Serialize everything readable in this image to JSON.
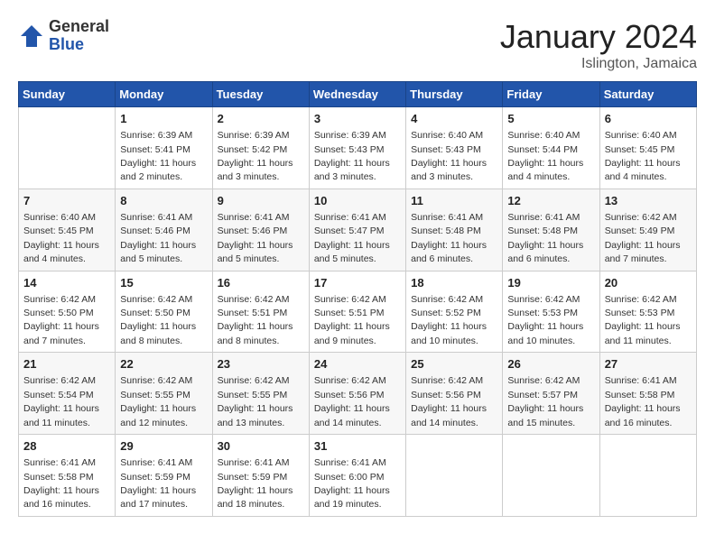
{
  "header": {
    "logo_general": "General",
    "logo_blue": "Blue",
    "month_title": "January 2024",
    "location": "Islington, Jamaica"
  },
  "days_of_week": [
    "Sunday",
    "Monday",
    "Tuesday",
    "Wednesday",
    "Thursday",
    "Friday",
    "Saturday"
  ],
  "weeks": [
    [
      {
        "day": null
      },
      {
        "day": "1",
        "sunrise": "Sunrise: 6:39 AM",
        "sunset": "Sunset: 5:41 PM",
        "daylight": "Daylight: 11 hours and 2 minutes."
      },
      {
        "day": "2",
        "sunrise": "Sunrise: 6:39 AM",
        "sunset": "Sunset: 5:42 PM",
        "daylight": "Daylight: 11 hours and 3 minutes."
      },
      {
        "day": "3",
        "sunrise": "Sunrise: 6:39 AM",
        "sunset": "Sunset: 5:43 PM",
        "daylight": "Daylight: 11 hours and 3 minutes."
      },
      {
        "day": "4",
        "sunrise": "Sunrise: 6:40 AM",
        "sunset": "Sunset: 5:43 PM",
        "daylight": "Daylight: 11 hours and 3 minutes."
      },
      {
        "day": "5",
        "sunrise": "Sunrise: 6:40 AM",
        "sunset": "Sunset: 5:44 PM",
        "daylight": "Daylight: 11 hours and 4 minutes."
      },
      {
        "day": "6",
        "sunrise": "Sunrise: 6:40 AM",
        "sunset": "Sunset: 5:45 PM",
        "daylight": "Daylight: 11 hours and 4 minutes."
      }
    ],
    [
      {
        "day": "7",
        "sunrise": "Sunrise: 6:40 AM",
        "sunset": "Sunset: 5:45 PM",
        "daylight": "Daylight: 11 hours and 4 minutes."
      },
      {
        "day": "8",
        "sunrise": "Sunrise: 6:41 AM",
        "sunset": "Sunset: 5:46 PM",
        "daylight": "Daylight: 11 hours and 5 minutes."
      },
      {
        "day": "9",
        "sunrise": "Sunrise: 6:41 AM",
        "sunset": "Sunset: 5:46 PM",
        "daylight": "Daylight: 11 hours and 5 minutes."
      },
      {
        "day": "10",
        "sunrise": "Sunrise: 6:41 AM",
        "sunset": "Sunset: 5:47 PM",
        "daylight": "Daylight: 11 hours and 5 minutes."
      },
      {
        "day": "11",
        "sunrise": "Sunrise: 6:41 AM",
        "sunset": "Sunset: 5:48 PM",
        "daylight": "Daylight: 11 hours and 6 minutes."
      },
      {
        "day": "12",
        "sunrise": "Sunrise: 6:41 AM",
        "sunset": "Sunset: 5:48 PM",
        "daylight": "Daylight: 11 hours and 6 minutes."
      },
      {
        "day": "13",
        "sunrise": "Sunrise: 6:42 AM",
        "sunset": "Sunset: 5:49 PM",
        "daylight": "Daylight: 11 hours and 7 minutes."
      }
    ],
    [
      {
        "day": "14",
        "sunrise": "Sunrise: 6:42 AM",
        "sunset": "Sunset: 5:50 PM",
        "daylight": "Daylight: 11 hours and 7 minutes."
      },
      {
        "day": "15",
        "sunrise": "Sunrise: 6:42 AM",
        "sunset": "Sunset: 5:50 PM",
        "daylight": "Daylight: 11 hours and 8 minutes."
      },
      {
        "day": "16",
        "sunrise": "Sunrise: 6:42 AM",
        "sunset": "Sunset: 5:51 PM",
        "daylight": "Daylight: 11 hours and 8 minutes."
      },
      {
        "day": "17",
        "sunrise": "Sunrise: 6:42 AM",
        "sunset": "Sunset: 5:51 PM",
        "daylight": "Daylight: 11 hours and 9 minutes."
      },
      {
        "day": "18",
        "sunrise": "Sunrise: 6:42 AM",
        "sunset": "Sunset: 5:52 PM",
        "daylight": "Daylight: 11 hours and 10 minutes."
      },
      {
        "day": "19",
        "sunrise": "Sunrise: 6:42 AM",
        "sunset": "Sunset: 5:53 PM",
        "daylight": "Daylight: 11 hours and 10 minutes."
      },
      {
        "day": "20",
        "sunrise": "Sunrise: 6:42 AM",
        "sunset": "Sunset: 5:53 PM",
        "daylight": "Daylight: 11 hours and 11 minutes."
      }
    ],
    [
      {
        "day": "21",
        "sunrise": "Sunrise: 6:42 AM",
        "sunset": "Sunset: 5:54 PM",
        "daylight": "Daylight: 11 hours and 11 minutes."
      },
      {
        "day": "22",
        "sunrise": "Sunrise: 6:42 AM",
        "sunset": "Sunset: 5:55 PM",
        "daylight": "Daylight: 11 hours and 12 minutes."
      },
      {
        "day": "23",
        "sunrise": "Sunrise: 6:42 AM",
        "sunset": "Sunset: 5:55 PM",
        "daylight": "Daylight: 11 hours and 13 minutes."
      },
      {
        "day": "24",
        "sunrise": "Sunrise: 6:42 AM",
        "sunset": "Sunset: 5:56 PM",
        "daylight": "Daylight: 11 hours and 14 minutes."
      },
      {
        "day": "25",
        "sunrise": "Sunrise: 6:42 AM",
        "sunset": "Sunset: 5:56 PM",
        "daylight": "Daylight: 11 hours and 14 minutes."
      },
      {
        "day": "26",
        "sunrise": "Sunrise: 6:42 AM",
        "sunset": "Sunset: 5:57 PM",
        "daylight": "Daylight: 11 hours and 15 minutes."
      },
      {
        "day": "27",
        "sunrise": "Sunrise: 6:41 AM",
        "sunset": "Sunset: 5:58 PM",
        "daylight": "Daylight: 11 hours and 16 minutes."
      }
    ],
    [
      {
        "day": "28",
        "sunrise": "Sunrise: 6:41 AM",
        "sunset": "Sunset: 5:58 PM",
        "daylight": "Daylight: 11 hours and 16 minutes."
      },
      {
        "day": "29",
        "sunrise": "Sunrise: 6:41 AM",
        "sunset": "Sunset: 5:59 PM",
        "daylight": "Daylight: 11 hours and 17 minutes."
      },
      {
        "day": "30",
        "sunrise": "Sunrise: 6:41 AM",
        "sunset": "Sunset: 5:59 PM",
        "daylight": "Daylight: 11 hours and 18 minutes."
      },
      {
        "day": "31",
        "sunrise": "Sunrise: 6:41 AM",
        "sunset": "Sunset: 6:00 PM",
        "daylight": "Daylight: 11 hours and 19 minutes."
      },
      {
        "day": null
      },
      {
        "day": null
      },
      {
        "day": null
      }
    ]
  ]
}
